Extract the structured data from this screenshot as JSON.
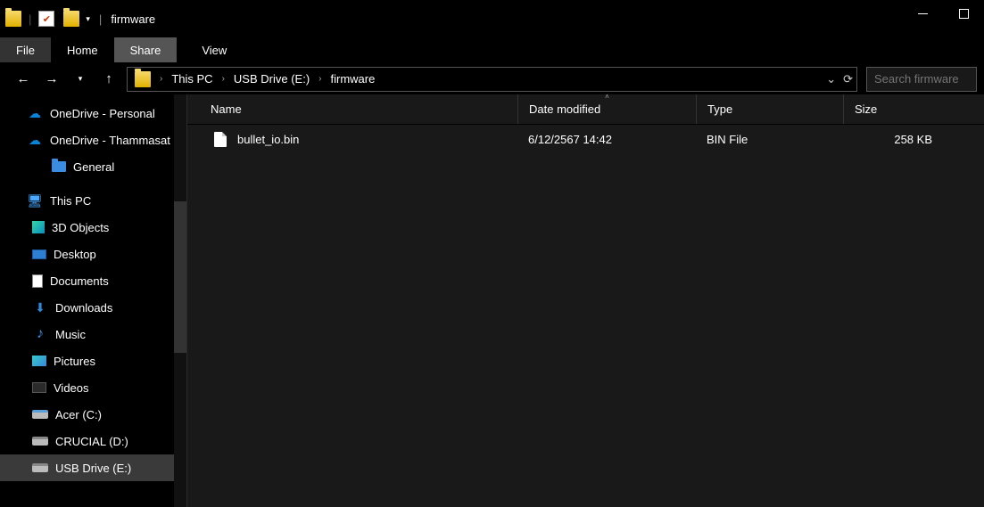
{
  "window": {
    "title": "firmware"
  },
  "ribbon": {
    "file": "File",
    "home": "Home",
    "share": "Share",
    "view": "View"
  },
  "breadcrumb": [
    "This PC",
    "USB Drive (E:)",
    "firmware"
  ],
  "search": {
    "placeholder": "Search firmware"
  },
  "tree": {
    "onedrive_personal": "OneDrive - Personal",
    "onedrive_thammasat": "OneDrive - Thammasat",
    "general": "General",
    "this_pc": "This PC",
    "objects3d": "3D Objects",
    "desktop": "Desktop",
    "documents": "Documents",
    "downloads": "Downloads",
    "music": "Music",
    "pictures": "Pictures",
    "videos": "Videos",
    "acer": "Acer (C:)",
    "crucial": "CRUCIAL (D:)",
    "usb": "USB Drive (E:)"
  },
  "columns": {
    "name": "Name",
    "date": "Date modified",
    "type": "Type",
    "size": "Size"
  },
  "files": [
    {
      "name": "bullet_io.bin",
      "date": "6/12/2567 14:42",
      "type": "BIN File",
      "size": "258 KB"
    }
  ]
}
